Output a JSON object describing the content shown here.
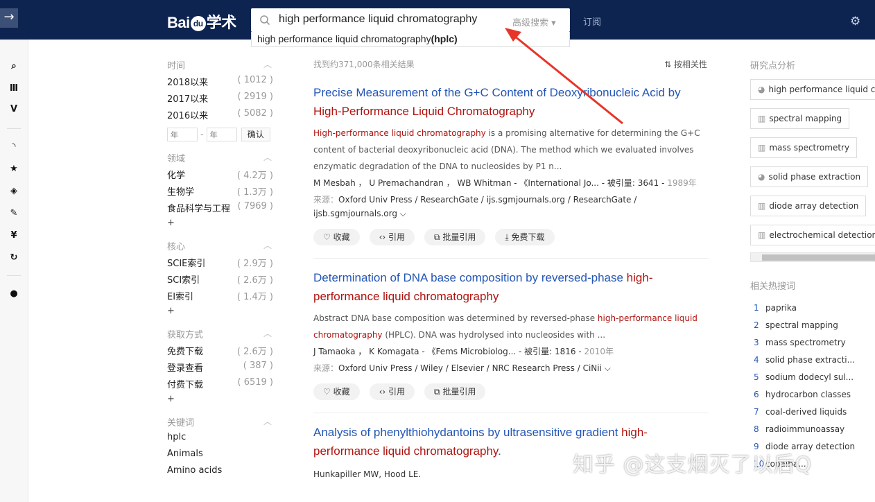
{
  "header": {
    "logo_text": "Bai",
    "logo_paw": "du",
    "logo_cn": "学术",
    "search_value": "high performance liquid chromatography",
    "advanced_search": "高级搜索 ▾",
    "suggestion_main": "high performance liquid chromatography",
    "suggestion_bold": "(hplc)",
    "subscribe": "订阅"
  },
  "filters": {
    "time": {
      "title": "时间",
      "items": [
        {
          "label": "2018以来",
          "count": "( 1012 )"
        },
        {
          "label": "2017以来",
          "count": "( 2919 )"
        },
        {
          "label": "2016以来",
          "count": "( 5082 )"
        }
      ],
      "year_placeholder": "年",
      "confirm": "确认"
    },
    "field": {
      "title": "领域",
      "items": [
        {
          "label": "化学",
          "count": "( 4.2万 )"
        },
        {
          "label": "生物学",
          "count": "( 1.3万 )"
        },
        {
          "label": "食品科学与工程",
          "count": "( 7969 )"
        }
      ]
    },
    "core": {
      "title": "核心",
      "items": [
        {
          "label": "SCIE索引",
          "count": "( 2.9万 )"
        },
        {
          "label": "SCI索引",
          "count": "( 2.6万 )"
        },
        {
          "label": "EI索引",
          "count": "( 1.4万 )"
        }
      ]
    },
    "access": {
      "title": "获取方式",
      "items": [
        {
          "label": "免费下载",
          "count": "( 2.6万 )"
        },
        {
          "label": "登录查看",
          "count": "( 387 )"
        },
        {
          "label": "付费下载",
          "count": "( 6519 )"
        }
      ]
    },
    "keywords": {
      "title": "关键词",
      "items": [
        "hplc",
        "Animals",
        "Amino acids"
      ]
    },
    "plus": "+"
  },
  "results": {
    "count_text": "找到约371,000条相关结果",
    "sort_label": "按相关性",
    "items": [
      {
        "title_a": "Precise Measurement of the G+C Content of Deoxyribonucleic Acid by ",
        "title_hl": "High-Performance Liquid Chromatography",
        "title_b": "",
        "abs_hl": "High-performance liquid chromatography",
        "abs_rest": " is a promising alternative for determining the G+C content of bacterial deoxyribonucleic acid (DNA). The method which we evaluated involves enzymatic degradation of the DNA to nucleosides by P1 n...",
        "authors": "M Mesbah ， U Premachandran ， WB Whitman - 《International Jo... - 被引量: 3641 - ",
        "year": "1989年",
        "source_label": "来源：",
        "sources": "Oxford Univ Press / ResearchGate / ijs.sgmjournals.org / ResearchGate / ijsb.sgmjournals.org ⌵",
        "actions": [
          "♡ 收藏",
          "‹› 引用",
          "⧉ 批量引用",
          "⤓ 免费下载"
        ]
      },
      {
        "title_a": "Determination of DNA base composition by reversed-phase ",
        "title_hl": "high-performance liquid chromatography",
        "title_b": "",
        "abs_pre": "Abstract DNA base composition was determined by reversed-phase ",
        "abs_hl": "high-performance liquid chromatography",
        "abs_rest": " (HPLC). DNA was hydrolysed into nucleosides with ...",
        "authors": "J Tamaoka ， K Komagata - 《Fems Microbiolog... - 被引量: 1816 - ",
        "year": "2010年",
        "source_label": "来源：",
        "sources": "Oxford Univ Press / Wiley / Elsevier / NRC Research Press / CiNii ⌵",
        "actions": [
          "♡ 收藏",
          "‹› 引用",
          "⧉ 批量引用"
        ]
      },
      {
        "title_a": "Analysis of phenylthiohydantoins by ultrasensitive gradient ",
        "title_hl": "high-performance liquid chromatography",
        "title_b": ".",
        "authors": "Hunkapiller MW, Hood LE."
      }
    ]
  },
  "right": {
    "analysis_title": "研究点分析",
    "tags": [
      {
        "icon": "◕",
        "label": "high performance liquid chromatography"
      },
      {
        "icon": "▥",
        "label": "spectral mapping"
      },
      {
        "icon": "▥",
        "label": "mass spectrometry"
      },
      {
        "icon": "◕",
        "label": "solid phase extraction"
      },
      {
        "icon": "▥",
        "label": "diode array detection"
      },
      {
        "icon": "▥",
        "label": "electrochemical detection"
      }
    ],
    "hot_title": "相关热搜词",
    "hot": [
      {
        "n": "1",
        "t": "paprika"
      },
      {
        "n": "2",
        "t": "spectral mapping"
      },
      {
        "n": "3",
        "t": "mass spectrometry"
      },
      {
        "n": "4",
        "t": "solid phase extracti..."
      },
      {
        "n": "5",
        "t": "sodium dodecyl sul..."
      },
      {
        "n": "6",
        "t": "hydrocarbon classes"
      },
      {
        "n": "7",
        "t": "coal-derived liquids"
      },
      {
        "n": "8",
        "t": "radioimmunoassay"
      },
      {
        "n": "9",
        "t": "diode array detection"
      },
      {
        "n": "10",
        "t": "copaiba..."
      }
    ]
  },
  "watermark": "知乎 @这支烟灭了以后Q",
  "colors": {
    "topbar": "#0e2450",
    "link": "#2355b5",
    "highlight": "#b0130f",
    "arrow": "#e8352a"
  }
}
